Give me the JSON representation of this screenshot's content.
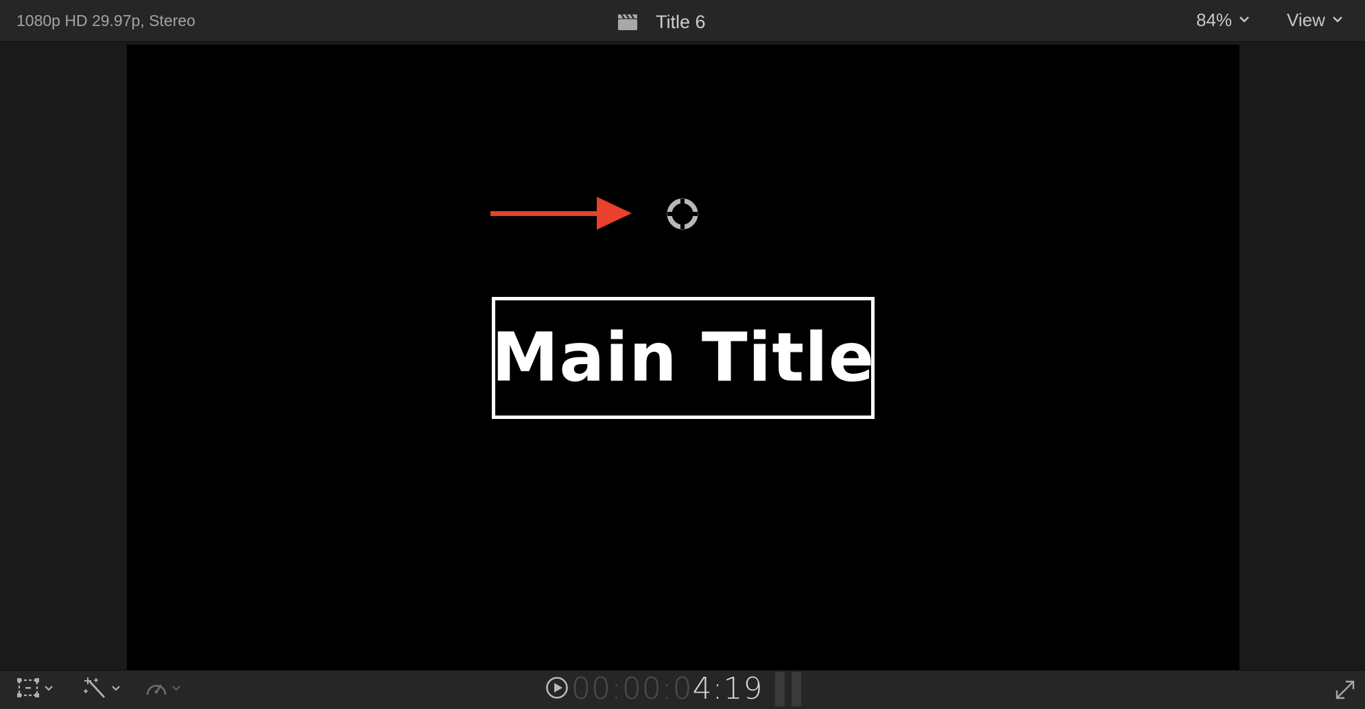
{
  "header": {
    "format_info": "1080p HD 29.97p, Stereo",
    "title": "Title 6",
    "clapper_icon": "clapperboard-icon",
    "zoom": "84%",
    "view_label": "View"
  },
  "canvas": {
    "main_title": "Main Title",
    "arrow_color": "#e8412c",
    "handle_icon": "position-target-icon"
  },
  "footer": {
    "transform_icon": "transform-crop-icon",
    "enhance_icon": "magic-wand-icon",
    "retime_icon": "speedometer-icon",
    "play_icon": "play-circle-icon",
    "timecode_dim": "00:00:0",
    "timecode_bright": "4:19",
    "fullscreen_icon": "fullscreen-icon"
  }
}
